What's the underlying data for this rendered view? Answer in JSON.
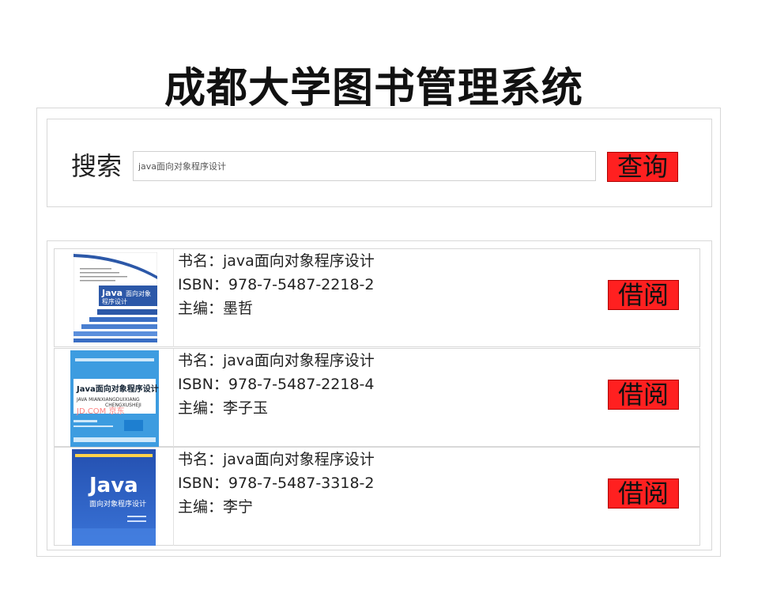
{
  "page": {
    "title": "成都大学图书管理系统"
  },
  "search": {
    "label": "搜索",
    "value": "java面向对象程序设计",
    "button_label": "查询"
  },
  "results": [
    {
      "title_line": "书名：java面向对象程序设计",
      "isbn_line": "ISBN：978-7-5487-2218-2",
      "editor_line": "主编：墨哲",
      "borrow_label": "借阅",
      "cover": {
        "main_text": "Java",
        "sub_text": "面向对象",
        "sub_text2": "程序设计"
      }
    },
    {
      "title_line": "书名：java面向对象程序设计",
      "isbn_line": "ISBN：978-7-5487-2218-4",
      "editor_line": "主编：李子玉",
      "borrow_label": "借阅",
      "cover": {
        "main_text": "Java面向对象程序设计",
        "sub_text": "JAVA MIANXIANGDUIXIANG",
        "sub_text2": "CHENGXUSHEJI",
        "watermark": "JD.COM 京东"
      }
    },
    {
      "title_line": "书名：java面向对象程序设计",
      "isbn_line": "ISBN：978-7-5487-3318-2",
      "editor_line": "主编：李宁",
      "borrow_label": "借阅",
      "cover": {
        "main_text": "Java",
        "sub_text": "面向对象程序设计"
      }
    }
  ],
  "colors": {
    "button_bg": "#ff2020",
    "border": "#d8d8d8",
    "cover1_accent": "#2c58a8",
    "cover2_bg": "#3d9ce0",
    "cover3_bg": "#2a56b8"
  }
}
